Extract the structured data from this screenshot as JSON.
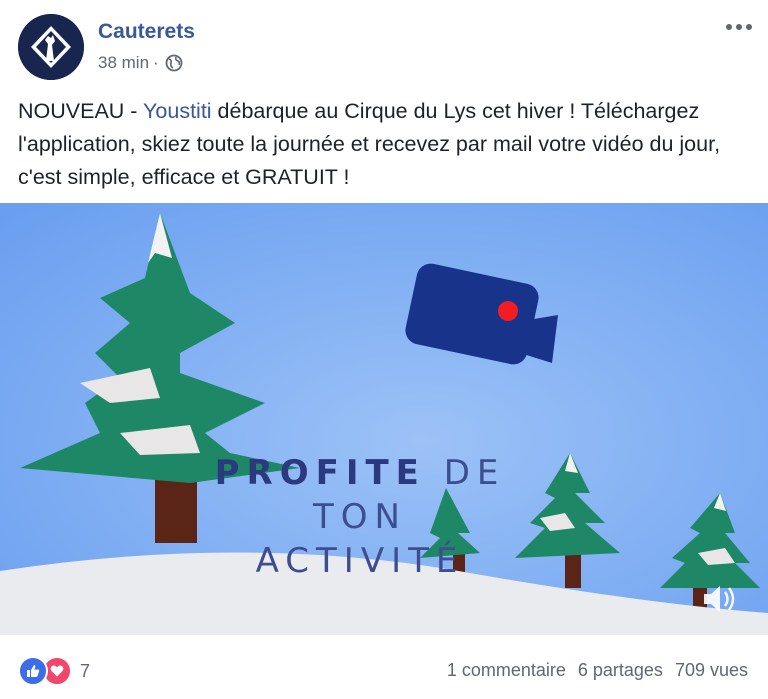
{
  "post": {
    "page_name": "Cauterets",
    "time": "38 min",
    "separator": "·",
    "audience_icon": "globe-icon",
    "more_icon": "more-options-icon",
    "text": {
      "part1": "NOUVEAU - ",
      "link": "Youstiti",
      "part2": " débarque au Cirque du Lys cet hiver ! Téléchargez l'application, skiez toute la journée et recevez par mail votre vidéo du jour, c'est simple, efficace et GRATUIT !"
    }
  },
  "video": {
    "overlay_line1_bold": "PROFITE",
    "overlay_line1_rest": " DE",
    "overlay_line2": "TON",
    "overlay_line3": "ACTIVITÉ",
    "sound_icon": "speaker-icon",
    "colors": {
      "sky": "#79a9f3",
      "tree": "#1e8766",
      "snow": "#e9ebee",
      "camera": "#17338a",
      "rec_dot": "#f21c24"
    }
  },
  "footer": {
    "reaction_icons": [
      "like-icon",
      "love-icon"
    ],
    "reaction_count": "7",
    "comments": "1 commentaire",
    "shares": "6 partages",
    "views": "709 vues"
  }
}
